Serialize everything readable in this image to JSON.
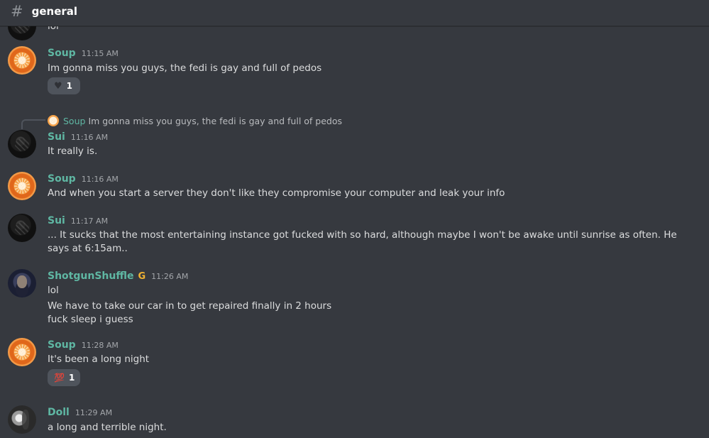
{
  "channel": {
    "name": "general"
  },
  "partial_message": {
    "text": "lol"
  },
  "messages": [
    {
      "author": "Soup",
      "time": "11:15 AM",
      "lines": [
        "Im gonna miss you guys, the fedi is gay and full of pedos"
      ],
      "reaction": {
        "emoji": "black-heart",
        "count": "1"
      }
    },
    {
      "author": "Sui",
      "time": "11:16 AM",
      "reply_to": {
        "author": "Soup",
        "text": "Im gonna miss you guys, the fedi is gay and full of pedos"
      },
      "lines": [
        "It really is."
      ]
    },
    {
      "author": "Soup",
      "time": "11:16 AM",
      "lines": [
        "And when you start a server they don't like they compromise your computer and leak your info"
      ]
    },
    {
      "author": "Sui",
      "time": "11:17 AM",
      "lines": [
        "... It sucks that the most entertaining instance got fucked with so hard, although maybe I won't be awake until sunrise as often. He says at 6:15am.."
      ]
    },
    {
      "author": "ShotgunShuffle",
      "time": "11:26 AM",
      "badge": "G",
      "lines": [
        "lol",
        "We have to take our car in to get repaired finally in 2 hours",
        "fuck sleep i guess"
      ]
    },
    {
      "author": "Soup",
      "time": "11:28 AM",
      "lines": [
        "It's been a long night"
      ],
      "reaction": {
        "emoji": "hundred-points",
        "count": "1"
      }
    },
    {
      "author": "Doll",
      "time": "11:29 AM",
      "lines": [
        "a long and terrible night."
      ]
    }
  ],
  "colors": {
    "background": "#36393f",
    "username": "#5fb7a3",
    "text": "#dcddde",
    "reaction_bg": "#4f545c"
  }
}
